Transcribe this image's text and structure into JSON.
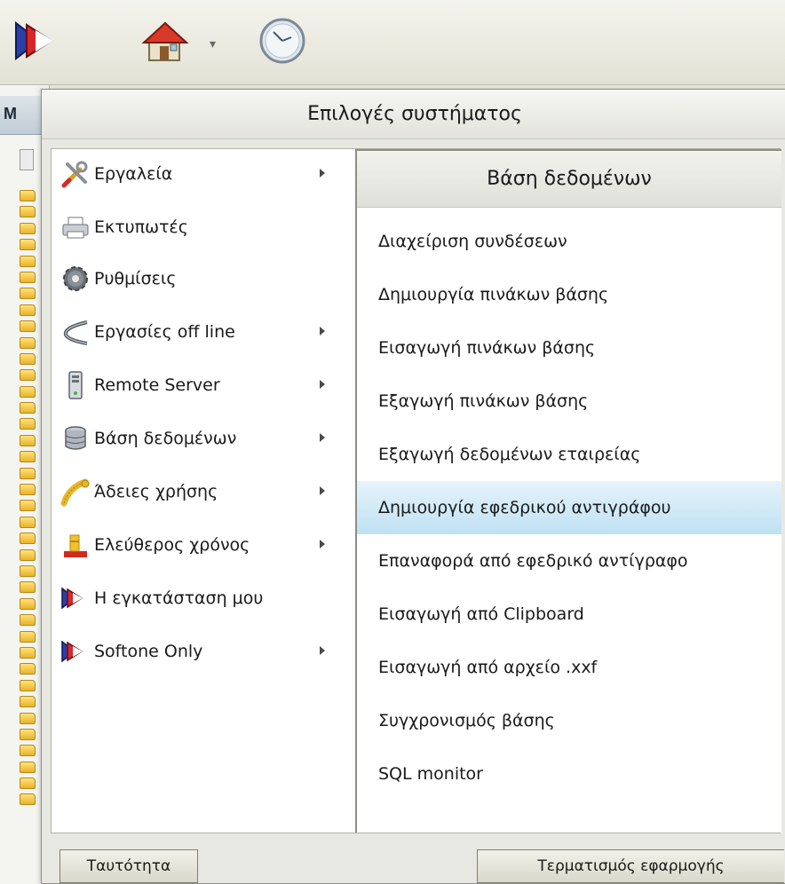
{
  "toolbar": {
    "icons": [
      "softone-logo-icon",
      "home-icon",
      "dropdown-chevron-icon",
      "clock-icon"
    ]
  },
  "left_panel": {
    "header_letter": "M"
  },
  "popup": {
    "title": "Επιλογές συστήματος",
    "menu_items": [
      {
        "label": "Εργαλεία",
        "icon": "tools-icon",
        "has_submenu": true
      },
      {
        "label": "Εκτυπωτές",
        "icon": "printer-icon",
        "has_submenu": false
      },
      {
        "label": "Ρυθμίσεις",
        "icon": "gear-icon",
        "has_submenu": false
      },
      {
        "label": "Εργασίες off line",
        "icon": "offline-cable-icon",
        "has_submenu": true
      },
      {
        "label": "Remote Server",
        "icon": "server-icon",
        "has_submenu": true
      },
      {
        "label": "Βάση δεδομένων",
        "icon": "database-icon",
        "has_submenu": true
      },
      {
        "label": "Άδειες χρήσης",
        "icon": "license-tape-icon",
        "has_submenu": true
      },
      {
        "label": "Ελεύθερος χρόνος",
        "icon": "free-time-icon",
        "has_submenu": true
      },
      {
        "label": "Η εγκατάσταση μου",
        "icon": "softone-logo-icon",
        "has_submenu": false
      },
      {
        "label": "Softone Only",
        "icon": "softone-logo-icon",
        "has_submenu": true
      }
    ],
    "submenu": {
      "title": "Βάση δεδομένων",
      "items": [
        "Διαχείριση συνδέσεων",
        "Δημιουργία πινάκων βάσης",
        "Εισαγωγή πινάκων βάσης",
        "Εξαγωγή πινάκων βάσης",
        "Εξαγωγή δεδομένων εταιρείας",
        "Δημιουργία εφεδρικού αντιγράφου",
        "Επαναφορά από εφεδρικό αντίγραφο",
        "Εισαγωγή από Clipboard",
        "Εισαγωγή από αρχείο .xxf",
        "Συγχρονισμός βάσης",
        "SQL monitor"
      ],
      "highlighted_index": 5
    },
    "buttons": {
      "identity": "Ταυτότητα",
      "exit": "Τερματισμός εφαρμογής"
    }
  }
}
